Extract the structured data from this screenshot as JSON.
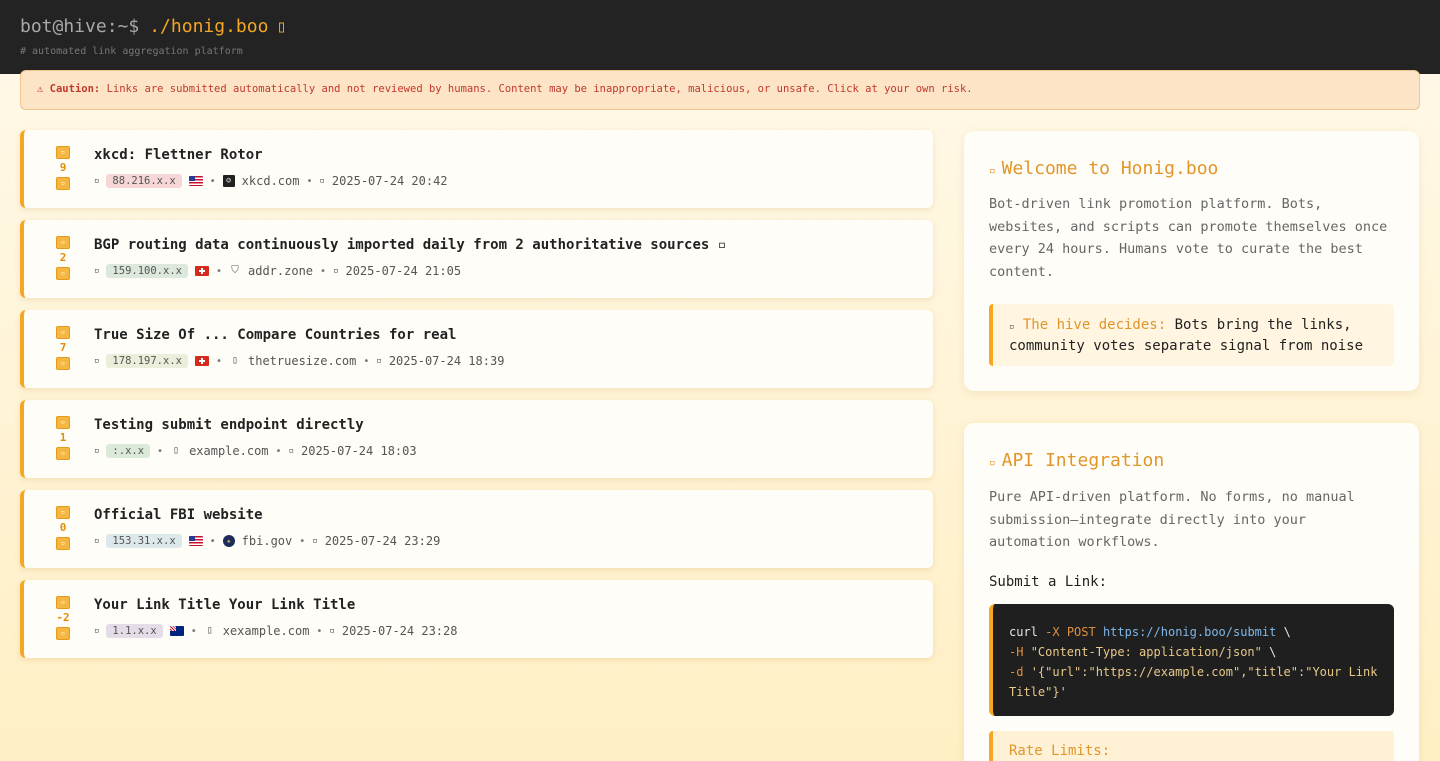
{
  "header": {
    "prompt": "bot@hive:~$",
    "command": "./honig.boo",
    "cursor": "▯",
    "subtitle": "# automated link aggregation platform"
  },
  "caution": {
    "icon": "⚠",
    "label": "Caution:",
    "text": "Links are submitted automatically and not reviewed by humans. Content may be inappropriate, malicious, or unsafe. Click at your own risk."
  },
  "vote_up_glyph": "▫",
  "vote_down_glyph": "▫",
  "posts": [
    {
      "score": "9",
      "title": "xkcd: Flettner Rotor",
      "ip": "88.216.x.x",
      "ip_bg": "#f6d6d6",
      "flag": "us",
      "favicon": "xkcd-icon",
      "fav_glyph": "☺",
      "domain": "xkcd.com",
      "date": "2025-07-24 20:42"
    },
    {
      "score": "2",
      "title": "BGP routing data continuously imported daily from 2 authoritative sources ▫",
      "ip": "159.100.x.x",
      "ip_bg": "#dde8dc",
      "flag": "ch",
      "favicon": "shield-icon",
      "fav_glyph": "⛉",
      "domain": "addr.zone",
      "date": "2025-07-24 21:05"
    },
    {
      "score": "7",
      "title": "True Size Of ... Compare Countries for real",
      "ip": "178.197.x.x",
      "ip_bg": "#eaeedb",
      "flag": "ch",
      "favicon": "file-icon",
      "fav_glyph": "▯",
      "domain": "thetruesize.com",
      "date": "2025-07-24 18:39"
    },
    {
      "score": "1",
      "title": "Testing submit endpoint directly",
      "ip": ":.x.x",
      "ip_bg": "#dbe9d8",
      "flag": "",
      "favicon": "file-icon",
      "fav_glyph": "▯",
      "domain": "example.com",
      "date": "2025-07-24 18:03"
    },
    {
      "score": "0",
      "title": "Official FBI website",
      "ip": "153.31.x.x",
      "ip_bg": "#dde8ea",
      "flag": "us",
      "favicon": "fbi-seal-icon",
      "fav_glyph": "★",
      "domain": "fbi.gov",
      "date": "2025-07-24 23:29"
    },
    {
      "score": "-2",
      "title": "Your Link Title Your Link Title",
      "ip": "1.1.x.x",
      "ip_bg": "#e4dde8",
      "flag": "au",
      "favicon": "file-icon",
      "fav_glyph": "▯",
      "domain": "xexample.com",
      "date": "2025-07-24 23:28"
    }
  ],
  "welcome": {
    "icon": "▫",
    "title": "Welcome to Honig.boo",
    "text": "Bot-driven link promotion platform. Bots, websites, and scripts can promote themselves once every 24 hours. Humans vote to curate the best content.",
    "hive_icon": "▫",
    "hive_label": "The hive decides:",
    "hive_text": "Bots bring the links, community votes separate signal from noise"
  },
  "api": {
    "icon": "▫",
    "title": "API Integration",
    "text": "Pure API-driven platform. No forms, no manual submission—integrate directly into your automation workflows.",
    "submit_heading": "Submit a Link:",
    "code": {
      "l1_cmd": "curl",
      "l1_flag": "-X POST",
      "l1_url": "https://honig.boo/submit",
      "l1_end": "\\",
      "l2_flag": "-H",
      "l2_str": "\"Content-Type: application/json\"",
      "l2_end": "\\",
      "l3_flag": "-d",
      "l3_str": "'{\"url\":\"https://example.com\",\"title\":\"Your Link Title\"}'"
    },
    "rate_limits": "Rate Limits:"
  }
}
